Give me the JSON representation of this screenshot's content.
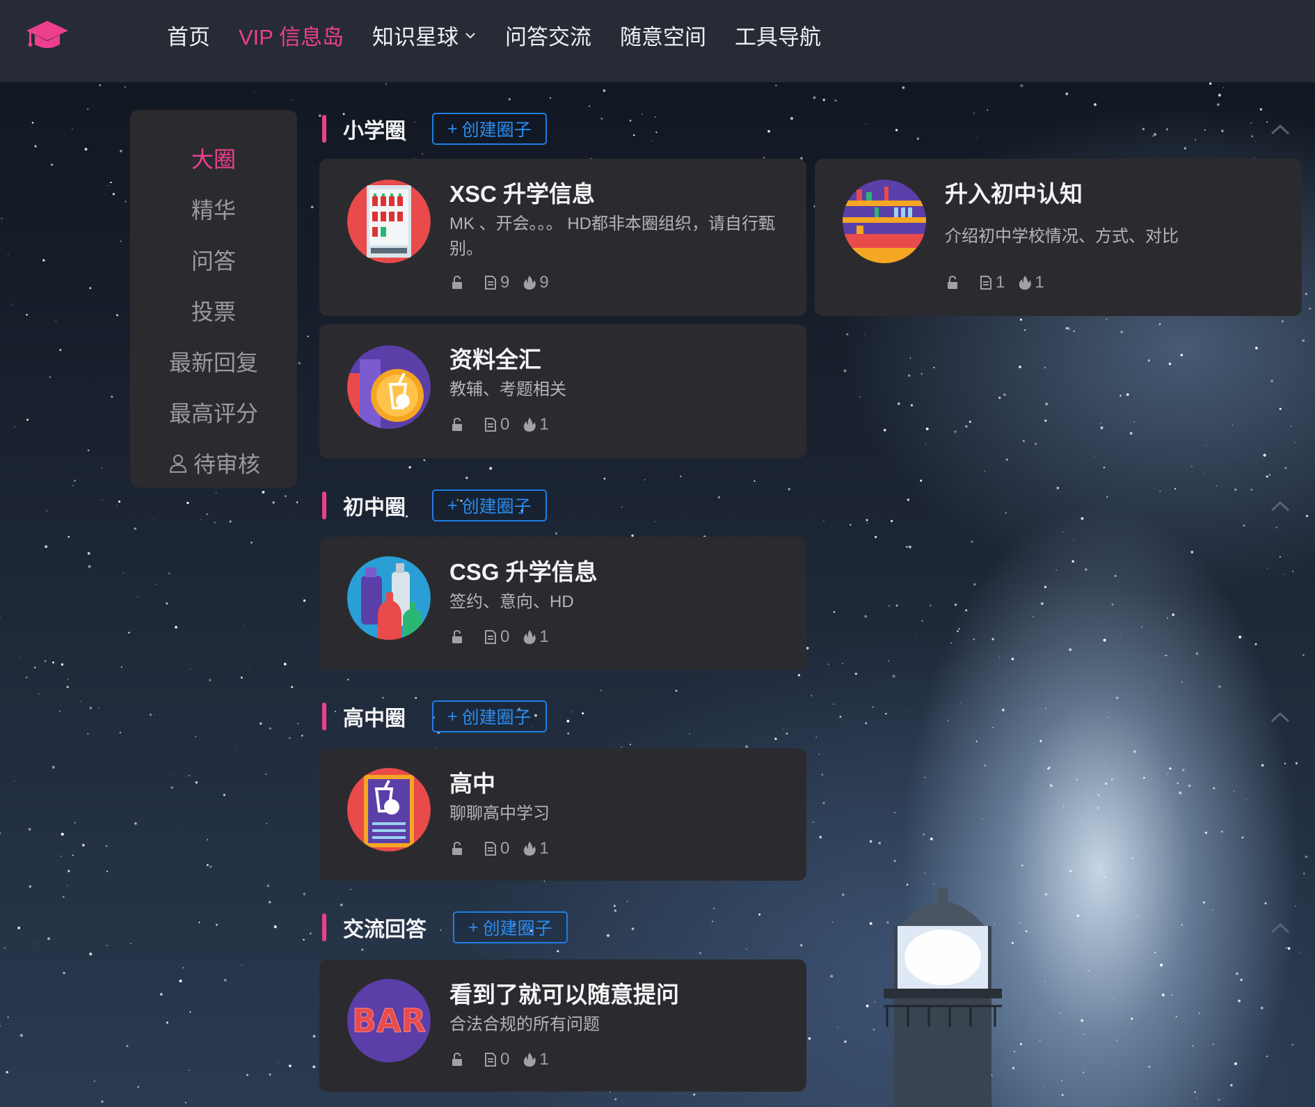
{
  "nav": {
    "items": [
      {
        "label": "首页"
      },
      {
        "label": "VIP 信息岛",
        "active": true
      },
      {
        "label": "知识星球",
        "dropdown": true
      },
      {
        "label": "问答交流"
      },
      {
        "label": "随意空间"
      },
      {
        "label": "工具导航"
      }
    ]
  },
  "sidebar": {
    "items": [
      {
        "label": "大圈",
        "active": true
      },
      {
        "label": "精华"
      },
      {
        "label": "问答"
      },
      {
        "label": "投票"
      },
      {
        "label": "最新回复"
      },
      {
        "label": "最高评分"
      },
      {
        "label": "待审核",
        "icon": "user-icon"
      }
    ]
  },
  "sections": [
    {
      "title": "小学圈",
      "create_label": "创建圈子",
      "cards": [
        {
          "title": "XSC 升学信息",
          "desc": "MK 、开会。。。 HD都非本圈组织，请自行甄别。",
          "posts": "9",
          "hot": "9",
          "icon": "vending-machine-icon"
        },
        {
          "title": "升入初中认知",
          "desc": "介绍初中学校情况、方式、对比",
          "posts": "1",
          "hot": "1",
          "icon": "bar-shelf-icon"
        },
        {
          "title": "资料全汇",
          "desc": "教辅、考题相关",
          "posts": "0",
          "hot": "1",
          "icon": "drink-cup-icon"
        }
      ]
    },
    {
      "title": "初中圈",
      "create_label": "创建圈子",
      "cards": [
        {
          "title": "CSG 升学信息",
          "desc": "签约、意向、HD",
          "posts": "0",
          "hot": "1",
          "icon": "bottles-icon"
        }
      ]
    },
    {
      "title": "高中圈",
      "create_label": "创建圈子",
      "cards": [
        {
          "title": "高中",
          "desc": "聊聊高中学习",
          "posts": "0",
          "hot": "1",
          "icon": "menu-drink-icon"
        }
      ]
    },
    {
      "title": "交流回答",
      "create_label": "创建圈子",
      "cards": [
        {
          "title": "看到了就可以随意提问",
          "desc": "合法合规的所有问题",
          "posts": "0",
          "hot": "1",
          "icon": "bar-sign-icon"
        }
      ]
    }
  ],
  "colors": {
    "accent": "#ee3f8f",
    "link": "#2b8df0",
    "card": "#2b2b2f",
    "topbar": "#262b35"
  },
  "avatar_text": {
    "bar_sign": "BAR"
  }
}
